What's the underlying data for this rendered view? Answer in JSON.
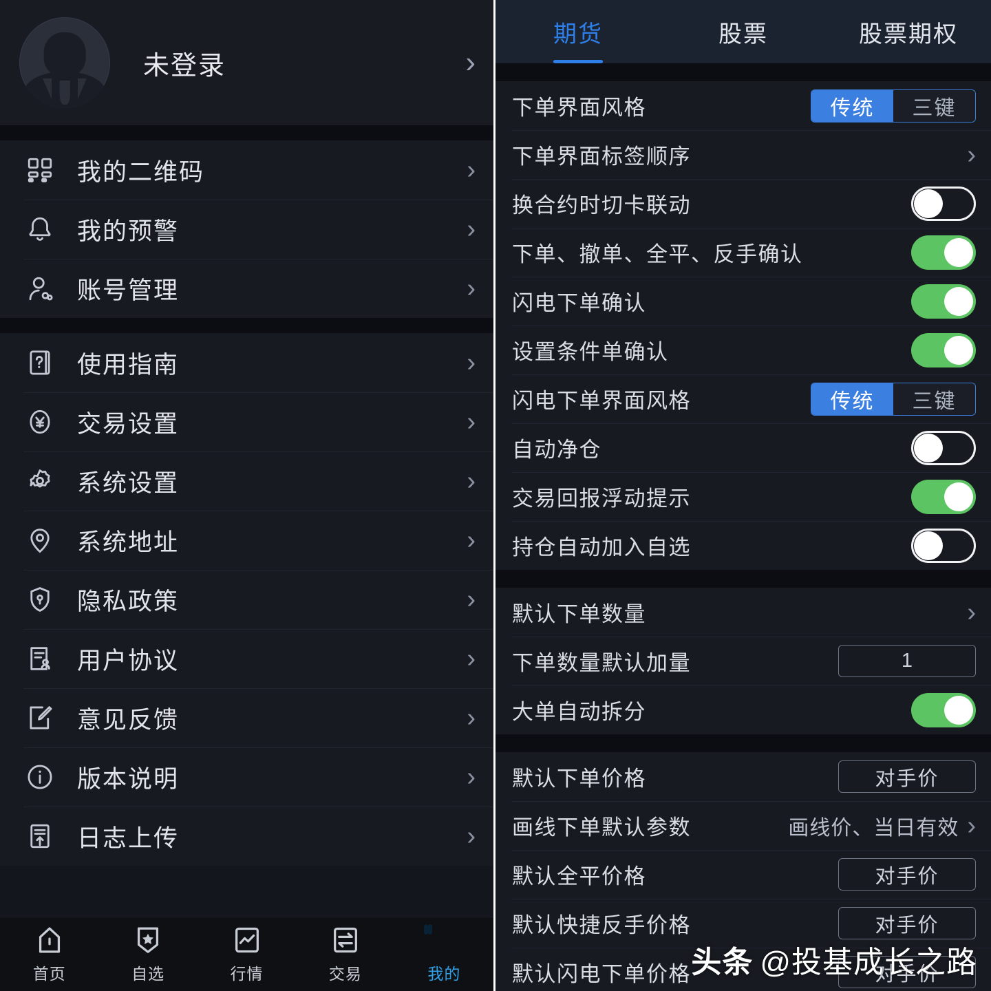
{
  "left": {
    "profile": {
      "name": "未登录",
      "chevron": "›",
      "avatar_icon": "default-user-avatar"
    },
    "groups": [
      {
        "items": [
          {
            "icon": "qrcode-icon",
            "label": "我的二维码",
            "chevron": "›"
          },
          {
            "icon": "bell-icon",
            "label": "我的预警",
            "chevron": "›"
          },
          {
            "icon": "user-account-icon",
            "label": "账号管理",
            "chevron": "›"
          }
        ]
      },
      {
        "items": [
          {
            "icon": "guide-book-icon",
            "label": "使用指南",
            "chevron": "›"
          },
          {
            "icon": "yuan-shield-icon",
            "label": "交易设置",
            "chevron": "›"
          },
          {
            "icon": "gear-icon",
            "label": "系统设置",
            "chevron": "›"
          },
          {
            "icon": "location-pin-icon",
            "label": "系统地址",
            "chevron": "›"
          },
          {
            "icon": "shield-lock-icon",
            "label": "隐私政策",
            "chevron": "›"
          },
          {
            "icon": "agreement-icon",
            "label": "用户协议",
            "chevron": "›"
          },
          {
            "icon": "feedback-edit-icon",
            "label": "意见反馈",
            "chevron": "›"
          },
          {
            "icon": "info-circle-icon",
            "label": "版本说明",
            "chevron": "›"
          },
          {
            "icon": "log-upload-icon",
            "label": "日志上传",
            "chevron": "›"
          }
        ]
      }
    ],
    "tabbar": {
      "active_color": "#2f9fe8",
      "items": [
        {
          "icon": "home-icon",
          "label": "首页",
          "active": false
        },
        {
          "icon": "star-badge-icon",
          "label": "自选",
          "active": false
        },
        {
          "icon": "market-chart-icon",
          "label": "行情",
          "active": false
        },
        {
          "icon": "trade-exchange-icon",
          "label": "交易",
          "active": false
        },
        {
          "icon": "profile-blob-icon",
          "label": "我的",
          "active": true
        }
      ]
    }
  },
  "right": {
    "tabs": [
      {
        "label": "期货",
        "active": true
      },
      {
        "label": "股票",
        "active": false
      },
      {
        "label": "股票期权",
        "active": false
      }
    ],
    "accent_blue": "#3b7fe0",
    "toggle_on_green": "#5cc462",
    "sections": [
      {
        "rows": [
          {
            "label": "下单界面风格",
            "control": "segment",
            "options": [
              "传统",
              "三键"
            ],
            "selected": "传统"
          },
          {
            "label": "下单界面标签顺序",
            "control": "chevron",
            "chevron": "›"
          },
          {
            "label": "换合约时切卡联动",
            "control": "toggle",
            "value": "off"
          },
          {
            "label": "下单、撤单、全平、反手确认",
            "control": "toggle",
            "value": "on"
          },
          {
            "label": "闪电下单确认",
            "control": "toggle",
            "value": "on"
          },
          {
            "label": "设置条件单确认",
            "control": "toggle",
            "value": "on"
          },
          {
            "label": "闪电下单界面风格",
            "control": "segment",
            "options": [
              "传统",
              "三键"
            ],
            "selected": "传统"
          },
          {
            "label": "自动净仓",
            "control": "toggle",
            "value": "off"
          },
          {
            "label": "交易回报浮动提示",
            "control": "toggle",
            "value": "on"
          },
          {
            "label": "持仓自动加入自选",
            "control": "toggle",
            "value": "off"
          }
        ]
      },
      {
        "rows": [
          {
            "label": "默认下单数量",
            "control": "chevron",
            "chevron": "›"
          },
          {
            "label": "下单数量默认加量",
            "control": "pill",
            "value": "1"
          },
          {
            "label": "大单自动拆分",
            "control": "toggle",
            "value": "on"
          }
        ]
      },
      {
        "rows": [
          {
            "label": "默认下单价格",
            "control": "pill",
            "value": "对手价"
          },
          {
            "label": "画线下单默认参数",
            "control": "text-chevron",
            "value": "画线价、当日有效",
            "chevron": "›"
          },
          {
            "label": "默认全平价格",
            "control": "pill",
            "value": "对手价"
          },
          {
            "label": "默认快捷反手价格",
            "control": "pill",
            "value": "对手价"
          },
          {
            "label": "默认闪电下单价格",
            "control": "pill",
            "value": "对手价"
          }
        ]
      }
    ]
  },
  "watermark": {
    "brand": "头条",
    "handle": "@投基成长之路"
  }
}
